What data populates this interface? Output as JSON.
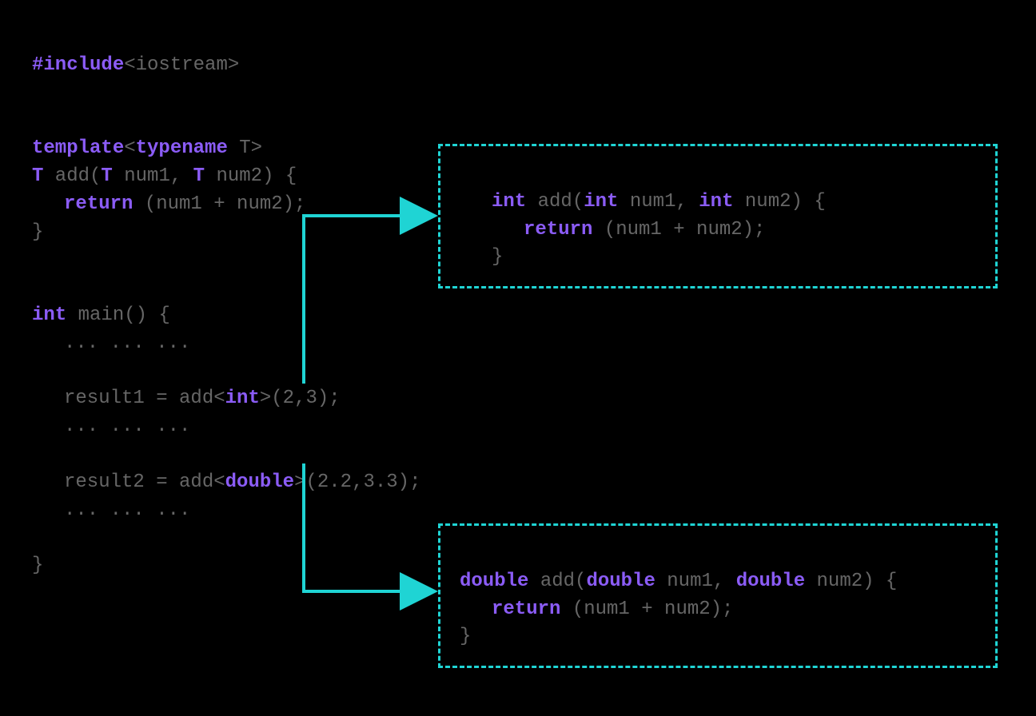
{
  "colors": {
    "keyword": "#8b5cf6",
    "text": "#666666",
    "accent": "#1fd4d4",
    "background": "#000000"
  },
  "code": {
    "include": "#include",
    "iostream": "<iostream>",
    "template": "template",
    "typename": "typename",
    "T": "T",
    "lt": "<",
    "gt": ">",
    "add": " add(",
    "num1": " num1, ",
    "num2": " num2) {",
    "return": "return",
    "return_body": " (num1 + num2);",
    "close_brace": "}",
    "int_kw": "int",
    "main": " main() {",
    "dots": "... ... ...",
    "result1_pre": "result1 = add<",
    "result1_post": ">(2,3);",
    "result2_pre": "result2 = add<",
    "double_kw": "double",
    "result2_post": ">(2.2,3.3);"
  },
  "box_int": {
    "type": "int",
    "add": " add(",
    "num1": " num1, ",
    "num2": " num2) {",
    "return": "return",
    "return_body": " (num1 + num2);",
    "close": "}"
  },
  "box_double": {
    "type": "double",
    "add": " add(",
    "num1": " num1, ",
    "num2": " num2) {",
    "return": "return",
    "return_body": " (num1 + num2);",
    "close": "}"
  }
}
